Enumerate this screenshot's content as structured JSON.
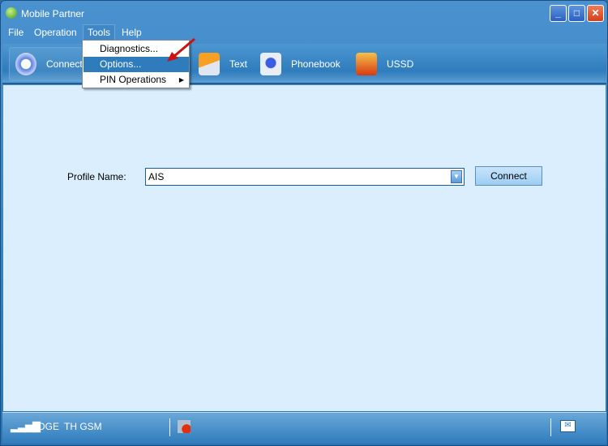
{
  "window": {
    "title": "Mobile Partner",
    "controls": [
      "minimize",
      "maximize",
      "close"
    ]
  },
  "menubar": [
    "File",
    "Operation",
    "Tools",
    "Help"
  ],
  "tools_menu": {
    "items": [
      {
        "label": "Diagnostics..."
      },
      {
        "label": "Options...",
        "highlighted": true
      },
      {
        "label": "PIN Operations",
        "submenu": true
      }
    ]
  },
  "toolbar": [
    {
      "label": "Connect",
      "icon": "connect-icon"
    },
    {
      "label": "Text",
      "icon": "envelope-icon"
    },
    {
      "label": "Phonebook",
      "icon": "phonebook-icon"
    },
    {
      "label": "USSD",
      "icon": "ussd-icon"
    }
  ],
  "main": {
    "profile_label": "Profile Name:",
    "profile_value": "AIS",
    "connect_button": "Connect"
  },
  "status": {
    "network": "EDGE",
    "operator": "TH GSM",
    "signal_icon": "signal-icon",
    "disconnected_icon": "disconnected-icon",
    "message_icon": "envelope-icon"
  },
  "colors": {
    "accent": "#2f7cbd",
    "content": "#dbeefe",
    "highlight_arrow": "#cc1111"
  }
}
